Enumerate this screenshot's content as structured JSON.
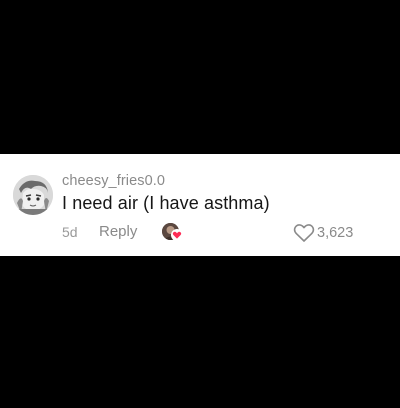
{
  "comment": {
    "username": "cheesy_fries0.0",
    "text": "I need air (I have asthma)",
    "timestamp": "5d",
    "reply_label": "Reply",
    "like_count": "3,623",
    "liked_by_creator": true
  },
  "icons": {
    "avatar": "user-avatar-icon",
    "creator_avatar": "creator-avatar-icon",
    "creator_heart": "heart-filled-icon",
    "like": "heart-outline-icon"
  },
  "colors": {
    "background": "#000000",
    "card": "#ffffff",
    "username": "#8a8a8a",
    "text": "#161616",
    "meta": "#9a9a9a",
    "creator_heart": "#fe2c55"
  }
}
